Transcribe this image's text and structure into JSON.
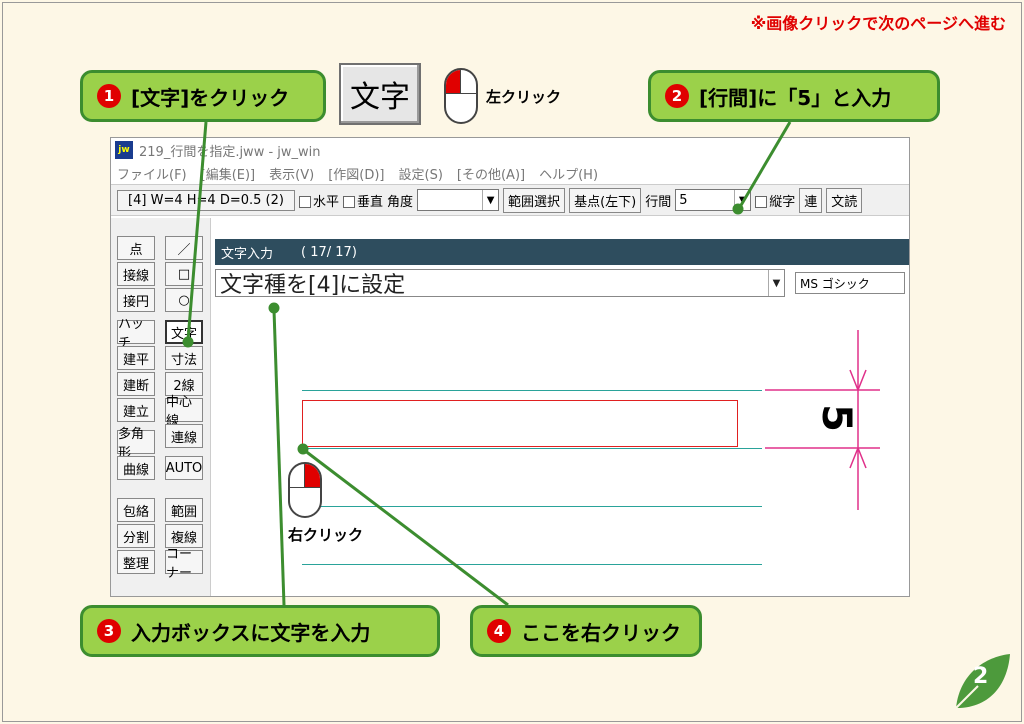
{
  "header": {
    "note": "※画像クリックで次のページへ進む"
  },
  "callouts": {
    "c1": {
      "num": "1",
      "text": "[文字]をクリック"
    },
    "c2": {
      "num": "2",
      "text": "[行間]に「5」と入力"
    },
    "c3": {
      "num": "3",
      "text": "入力ボックスに文字を入力"
    },
    "c4": {
      "num": "4",
      "text": "ここを右クリック"
    }
  },
  "big_button": {
    "label": "文字"
  },
  "mouse_labels": {
    "left_click": "左クリック",
    "right_click": "右クリック"
  },
  "window": {
    "title": "219_行間を指定.jww - jw_win",
    "logo": "jw",
    "menu": [
      "ファイル(F)",
      "[編集(E)]",
      "表示(V)",
      "[作図(D)]",
      "設定(S)",
      "[その他(A)]",
      "ヘルプ(H)"
    ],
    "toolbar": {
      "size_btn": "[4] W=4 H=4 D=0.5 (2)",
      "horiz": "水平",
      "vert": "垂直",
      "angle_label": "角度",
      "range_select": "範囲選択",
      "base_point": "基点(左下)",
      "line_gap_label": "行間",
      "line_gap_value": "5",
      "vertical_text": "縦字",
      "ren": "連",
      "read": "文読"
    },
    "tools_left": [
      "点",
      "接線",
      "接円",
      "ハッチ",
      "建平",
      "建断",
      "建立",
      "多角形",
      "曲線",
      "包絡",
      "分割",
      "整理"
    ],
    "tools_right": [
      "／",
      "□",
      "○",
      "文字",
      "寸法",
      "2線",
      "中心線",
      "連線",
      "AUTO",
      "範囲",
      "複線",
      "コーナー"
    ],
    "text_input": {
      "header_title": "文字入力",
      "header_count": "( 17/  17)",
      "value": "文字種を[4]に設定",
      "font": "MS ゴシック"
    },
    "dimension_label": "5"
  },
  "page_number": "2",
  "colors": {
    "callout_bg": "#9bd14a",
    "callout_border": "#3c8d2f",
    "accent_red": "#e00000",
    "leaf": "#4d9a3c"
  }
}
